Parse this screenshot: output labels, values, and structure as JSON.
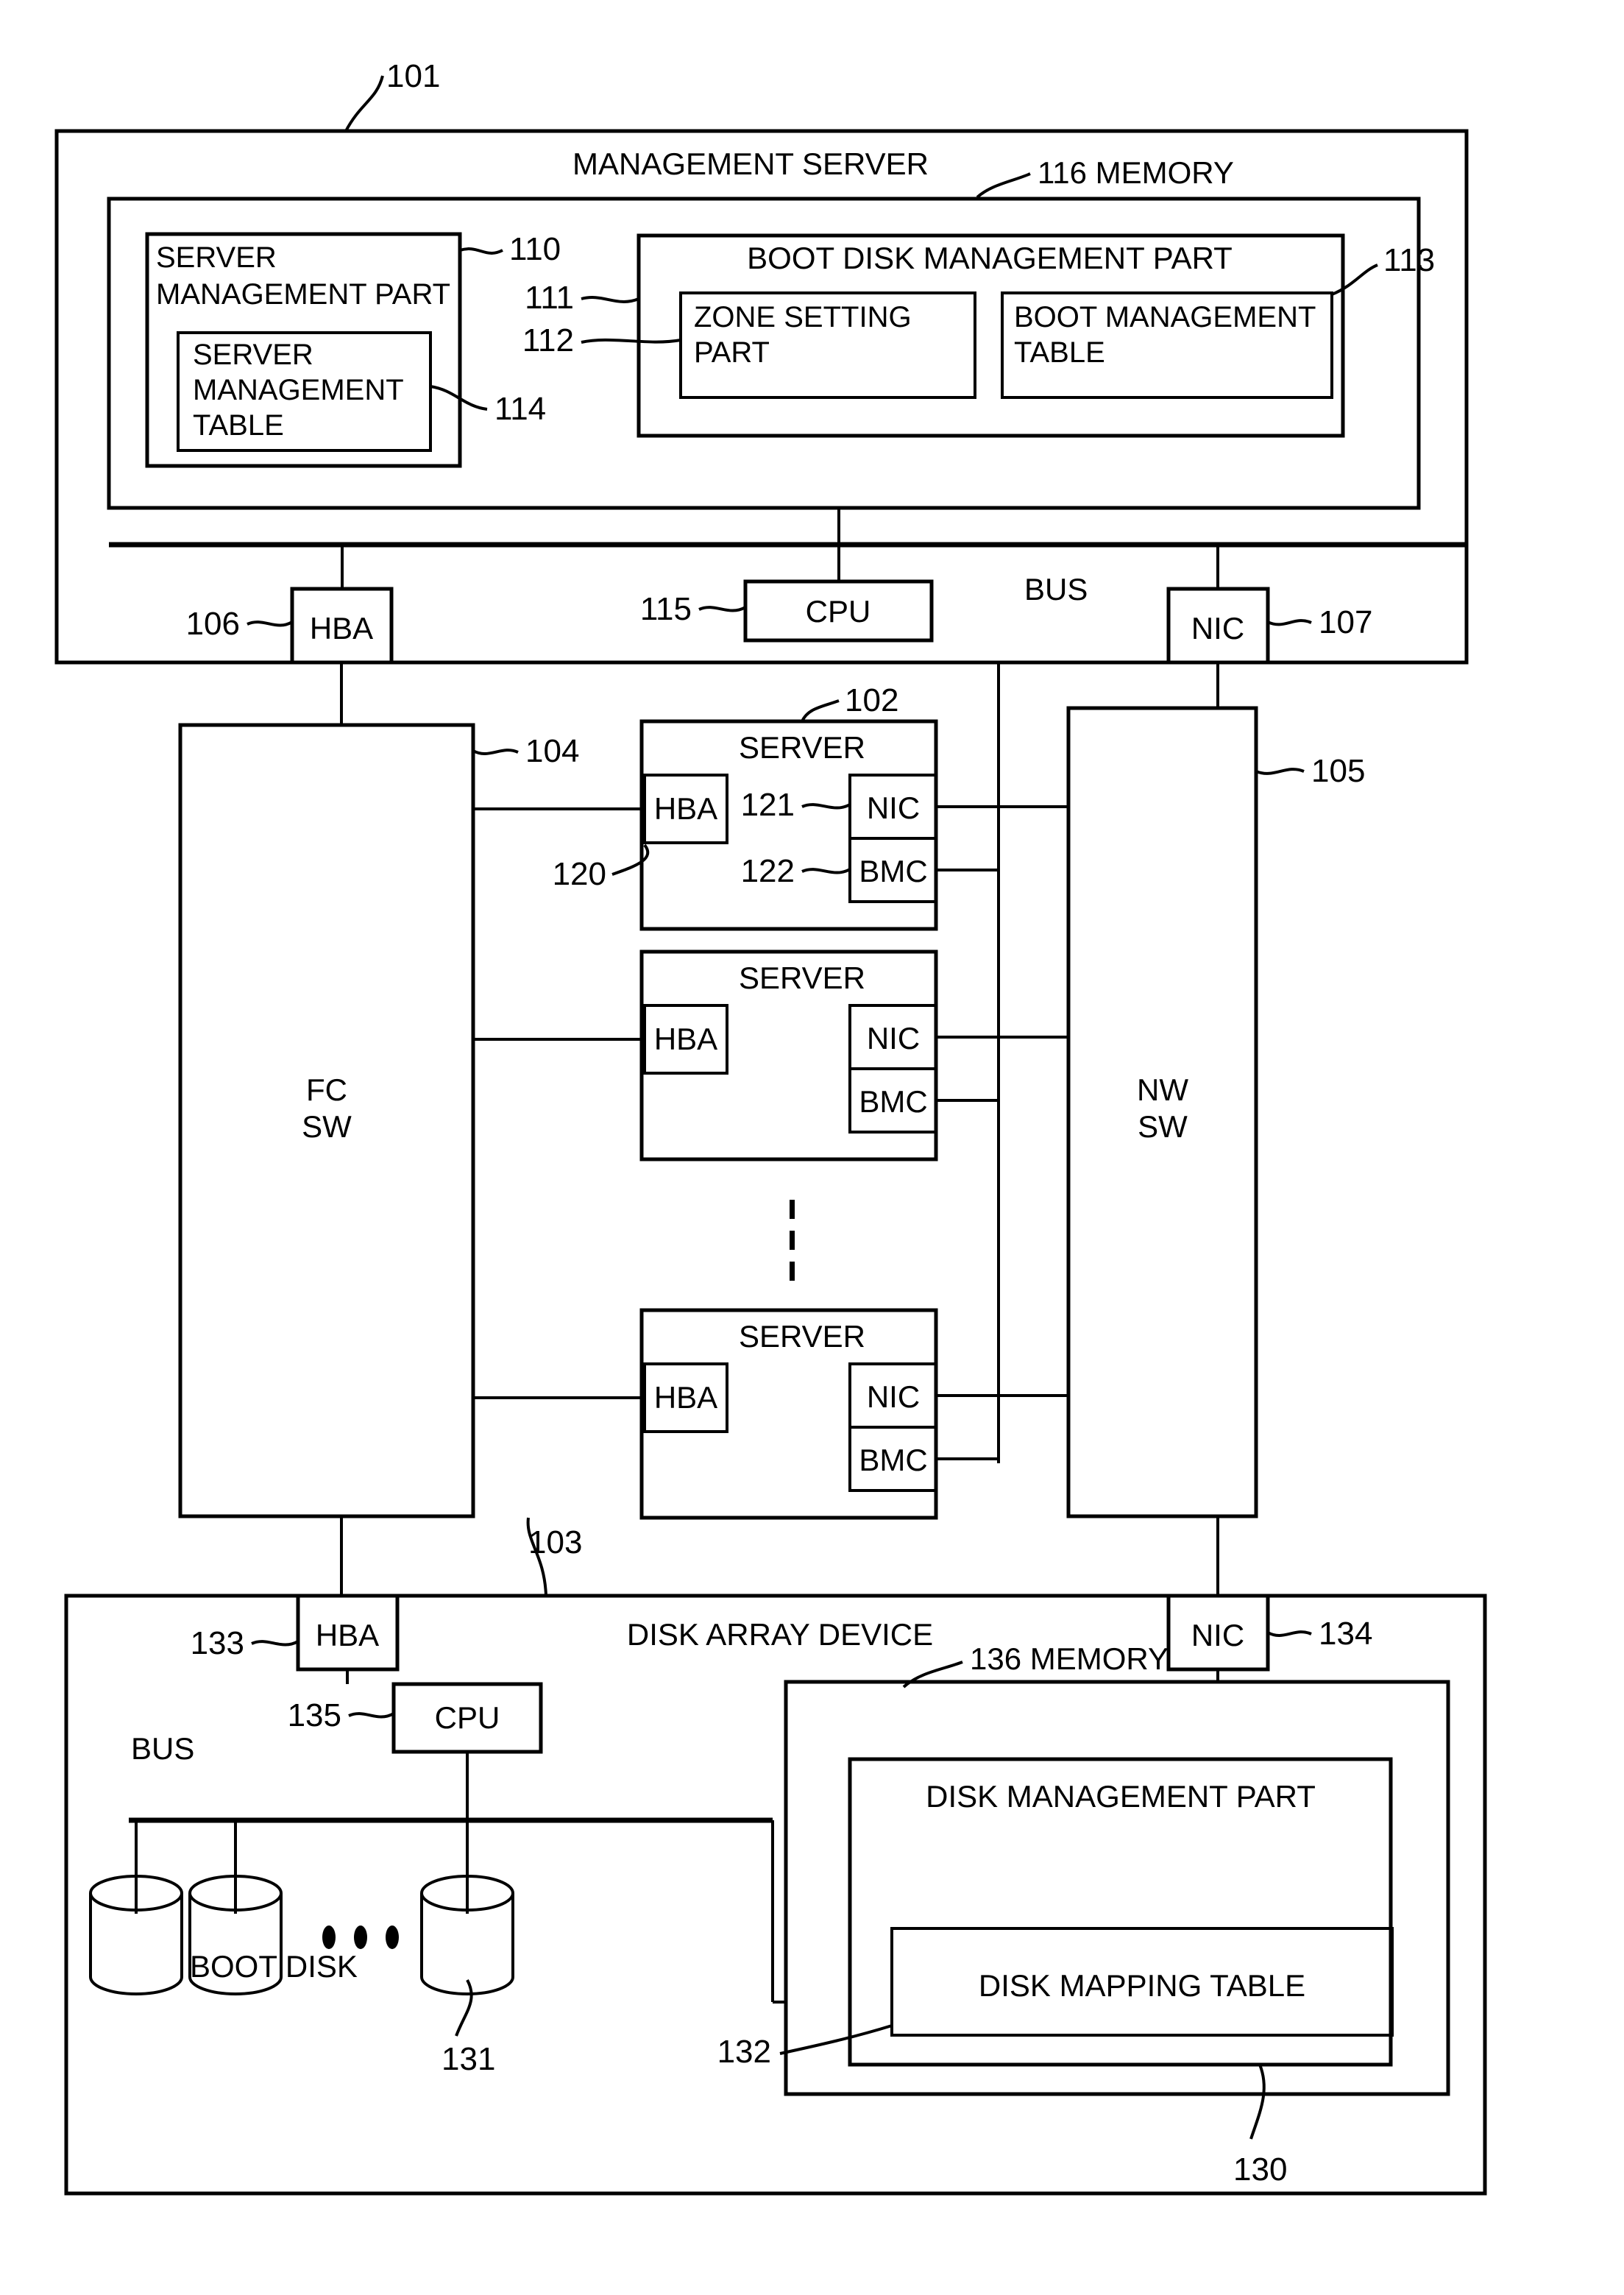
{
  "figure": {
    "type": "patent-block-diagram",
    "title": "Boot disk management system block diagram"
  },
  "management_server": {
    "ref": "101",
    "title": "MANAGEMENT SERVER",
    "memory": {
      "ref": "116",
      "label": "116 MEMORY"
    },
    "server_management_part": {
      "ref": "110",
      "line1": "SERVER",
      "line2": "MANAGEMENT PART",
      "table": {
        "ref": "114",
        "line1": "SERVER",
        "line2": "MANAGEMENT",
        "line3": "TABLE"
      }
    },
    "boot_disk_management_part": {
      "ref": "111",
      "label": "BOOT DISK MANAGEMENT PART",
      "zone_setting_part": {
        "ref": "112",
        "line1": "ZONE SETTING",
        "line2": "PART"
      },
      "boot_management_table": {
        "ref": "113",
        "line1": "BOOT MANAGEMENT",
        "line2": "TABLE"
      }
    },
    "bus_label": "BUS",
    "cpu": {
      "ref": "115",
      "label": "CPU"
    },
    "hba": {
      "ref": "106",
      "label": "HBA"
    },
    "nic": {
      "ref": "107",
      "label": "NIC"
    }
  },
  "fc_switch": {
    "ref": "104",
    "line1": "FC",
    "line2": "SW"
  },
  "nw_switch": {
    "ref": "105",
    "line1": "NW",
    "line2": "SW"
  },
  "servers": [
    {
      "ref": "102",
      "title": "SERVER",
      "hba": {
        "ref": "120",
        "label": "HBA"
      },
      "nic": {
        "ref": "121",
        "label": "NIC"
      },
      "bmc": {
        "ref": "122",
        "label": "BMC"
      }
    },
    {
      "ref": "",
      "title": "SERVER",
      "hba": {
        "ref": "",
        "label": "HBA"
      },
      "nic": {
        "ref": "",
        "label": "NIC"
      },
      "bmc": {
        "ref": "",
        "label": "BMC"
      }
    },
    {
      "ref": "",
      "title": "SERVER",
      "hba": {
        "ref": "",
        "label": "HBA"
      },
      "nic": {
        "ref": "",
        "label": "NIC"
      },
      "bmc": {
        "ref": "",
        "label": "BMC"
      }
    }
  ],
  "disk_array_device": {
    "ref": "103",
    "title": "DISK ARRAY DEVICE",
    "hba": {
      "ref": "133",
      "label": "HBA"
    },
    "nic": {
      "ref": "134",
      "label": "NIC"
    },
    "cpu": {
      "ref": "135",
      "label": "CPU"
    },
    "bus_label": "BUS",
    "memory": {
      "ref": "136",
      "label": "136 MEMORY"
    },
    "disk_management_part": {
      "ref": "130",
      "label": "DISK MANAGEMENT PART"
    },
    "disk_mapping_table": {
      "ref": "132",
      "label": "DISK MAPPING TABLE"
    },
    "boot_disk": {
      "ref": "131",
      "label": "BOOT DISK"
    }
  }
}
